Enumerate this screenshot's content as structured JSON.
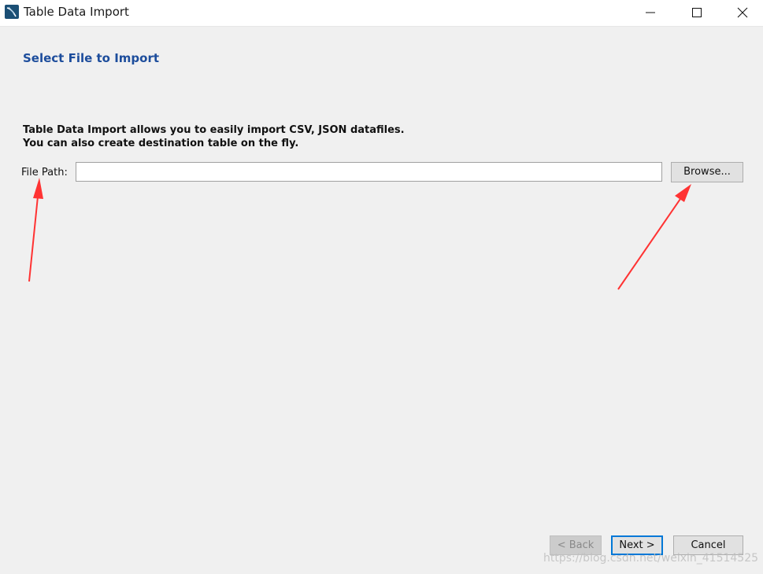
{
  "window": {
    "title": "Table Data Import",
    "icon": "mysql-workbench-icon"
  },
  "controls": {
    "minimize_icon": "minimize-icon",
    "maximize_icon": "maximize-icon",
    "close_icon": "close-icon"
  },
  "page": {
    "section_title": "Select File to Import",
    "description_line1": "Table Data Import allows you to easily import CSV, JSON datafiles.",
    "description_line2": "You can also create destination table on the fly."
  },
  "file_path": {
    "label": "File Path:",
    "value": "",
    "browse_label": "Browse..."
  },
  "footer": {
    "back_label": "< Back",
    "next_label": "Next >",
    "cancel_label": "Cancel"
  },
  "annotations": {
    "arrow_color": "#ff3333"
  },
  "watermark": "https://blog.csdn.net/weixin_41514525",
  "colors": {
    "section_title": "#1d4d9c",
    "next_border": "#0078d7"
  }
}
